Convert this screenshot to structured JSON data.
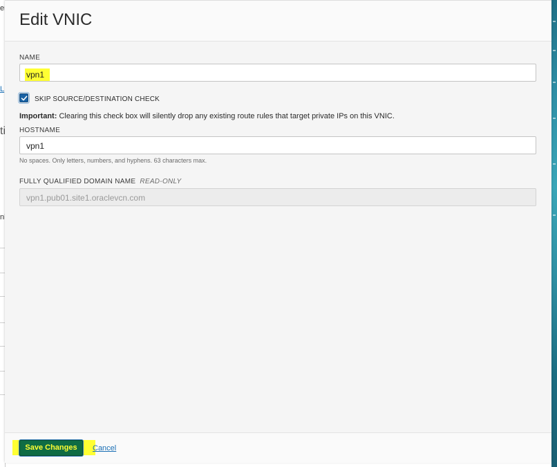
{
  "background": {
    "left_fragments": [
      "er",
      "L",
      "ti",
      "nl"
    ]
  },
  "modal": {
    "title": "Edit VNIC",
    "name_field": {
      "label": "NAME",
      "value": "vpn1"
    },
    "skip_check": {
      "label": "SKIP SOURCE/DESTINATION CHECK",
      "checked": true
    },
    "important": {
      "prefix": "Important:",
      "text": " Clearing this check box will silently drop any existing route rules that target private IPs on this VNIC."
    },
    "hostname_field": {
      "label": "HOSTNAME",
      "value": "vpn1",
      "helper": "No spaces. Only letters, numbers, and hyphens. 63 characters max."
    },
    "fqdn_field": {
      "label": "FULLY QUALIFIED DOMAIN NAME",
      "readonly_tag": "READ-ONLY",
      "value": "vpn1.pub01.site1.oraclevcn.com"
    },
    "footer": {
      "save_label": "Save Changes",
      "cancel_label": "Cancel"
    }
  },
  "colors": {
    "primary_button": "#0f6c44",
    "highlight": "#ffff33",
    "link": "#1a6fb5",
    "checkbox": "#1a62a3"
  }
}
